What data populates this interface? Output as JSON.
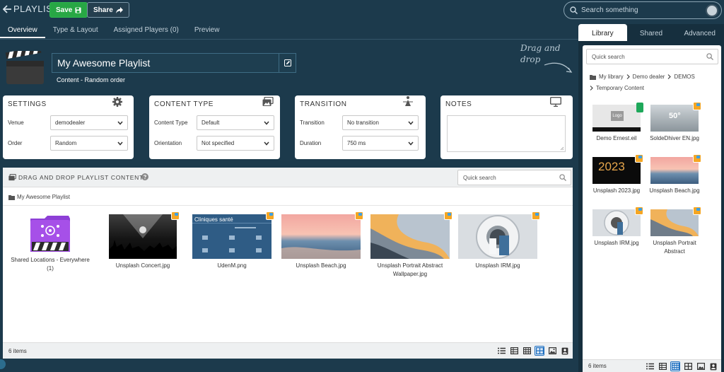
{
  "header": {
    "title": "PLAYLIST",
    "save_label": "Save",
    "share_label": "Share",
    "search_placeholder": "Search something"
  },
  "tabs": [
    {
      "label": "Overview",
      "active": true
    },
    {
      "label": "Type & Layout"
    },
    {
      "label": "Assigned Players (0)"
    },
    {
      "label": "Preview"
    }
  ],
  "playlist": {
    "name": "My Awesome Playlist",
    "subtitle": "Content - Random order",
    "hint": "Drag and drop"
  },
  "settings": {
    "title": "SETTINGS",
    "venue_label": "Venue",
    "venue_value": "demodealer",
    "order_label": "Order",
    "order_value": "Random"
  },
  "content_type": {
    "title": "CONTENT TYPE",
    "type_label": "Content Type",
    "type_value": "Default",
    "orientation_label": "Orientation",
    "orientation_value": "Not specified"
  },
  "transition": {
    "title": "TRANSITION",
    "transition_label": "Transition",
    "transition_value": "No transition",
    "duration_label": "Duration",
    "duration_value": "750 ms"
  },
  "notes": {
    "title": "NOTES"
  },
  "dnd": {
    "title": "DRAG AND DROP PLAYLIST CONTENT",
    "search_placeholder": "Quick search",
    "breadcrumb": "My Awesome Playlist",
    "items": [
      {
        "label": "Shared Locations - Everywhere (1)"
      },
      {
        "label": "Unsplash Concert.jpg"
      },
      {
        "label": "UdenM.png"
      },
      {
        "label": "Unsplash Beach.jpg"
      },
      {
        "label": "Unsplash Portrait Abstract Wallpaper.jpg"
      },
      {
        "label": "Unsplash IRM.jpg"
      }
    ],
    "count": "6 items",
    "thumb_text": "Cliniques santé"
  },
  "library": {
    "tabs": [
      {
        "label": "Library",
        "active": true
      },
      {
        "label": "Shared"
      },
      {
        "label": "Advanced"
      }
    ],
    "search_placeholder": "Quick search",
    "crumbs": [
      "My library",
      "Demo dealer",
      "DEMOS",
      "Temporary Content"
    ],
    "items": [
      {
        "label": "Demo Ernest.eil"
      },
      {
        "label": "SoldeDhiver EN.jpg"
      },
      {
        "label": "Unsplash 2023.jpg"
      },
      {
        "label": "Unsplash Beach.jpg"
      },
      {
        "label": "Unsplash IRM.jpg"
      },
      {
        "label": "Unsplash Portrait Abstract"
      }
    ],
    "count": "6 items",
    "thumb_2023": "2023",
    "thumb_50": "50°",
    "thumb_logo": "Logo"
  },
  "colors": {
    "accent": "#28a745",
    "background": "#1c3a4c",
    "badge": "#f5a623"
  }
}
